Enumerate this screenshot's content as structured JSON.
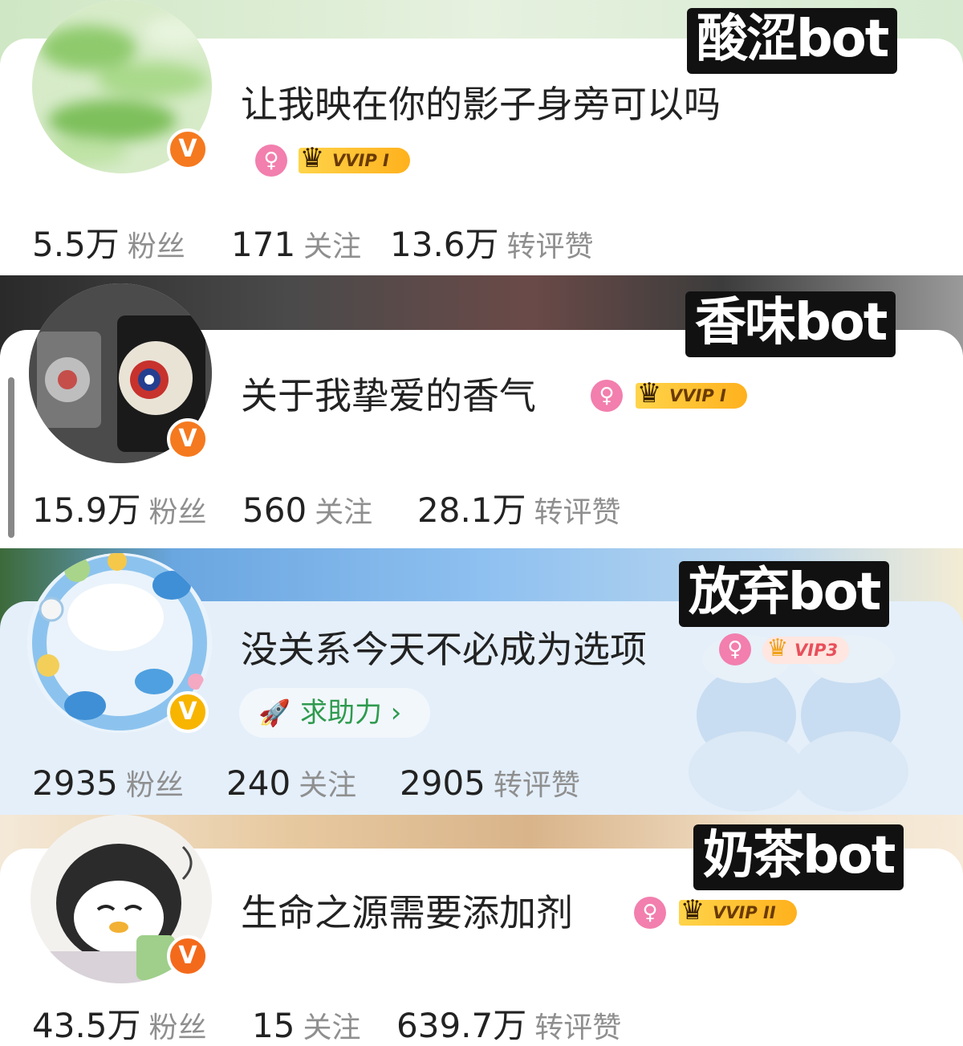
{
  "profiles": [
    {
      "tag": "酸涩bot",
      "bio": "让我映在你的影子身旁可以吗",
      "gender_symbol": "♀",
      "membership": "VVIP I",
      "stats": [
        {
          "value": "5.5万",
          "label": "粉丝"
        },
        {
          "value": "171",
          "label": "关注"
        },
        {
          "value": "13.6万",
          "label": "转评赞"
        }
      ]
    },
    {
      "tag": "香味bot",
      "bio": "关于我挚爱的香气",
      "gender_symbol": "♀",
      "membership": "VVIP I",
      "stats": [
        {
          "value": "15.9万",
          "label": "粉丝"
        },
        {
          "value": "560",
          "label": "关注"
        },
        {
          "value": "28.1万",
          "label": "转评赞"
        }
      ]
    },
    {
      "tag": "放弃bot",
      "bio": "没关系今天不必成为选项",
      "gender_symbol": "♀",
      "membership": "VIP3",
      "helper_label": "求助力 ›",
      "stats": [
        {
          "value": "2935",
          "label": "粉丝"
        },
        {
          "value": "240",
          "label": "关注"
        },
        {
          "value": "2905",
          "label": "转评赞"
        }
      ]
    },
    {
      "tag": "奶茶bot",
      "bio": "生命之源需要添加剂",
      "gender_symbol": "♀",
      "membership": "VVIP II",
      "stats": [
        {
          "value": "43.5万",
          "label": "粉丝"
        },
        {
          "value": "15",
          "label": "关注"
        },
        {
          "value": "639.7万",
          "label": "转评赞"
        }
      ]
    }
  ],
  "verified_badge": "V",
  "icons": {
    "gender": "female-icon",
    "crown": "crown-icon",
    "helper": "rocket-icon",
    "verified": "verified-v-icon"
  },
  "colors": {
    "verified_orange": "#f5791f",
    "verified_yellow": "#f7b500",
    "gender_pink": "#f27fae",
    "vip_gold": "#ffc22e",
    "helper_green": "#2e9a4e",
    "stat_label_gray": "#8f8f8f"
  }
}
